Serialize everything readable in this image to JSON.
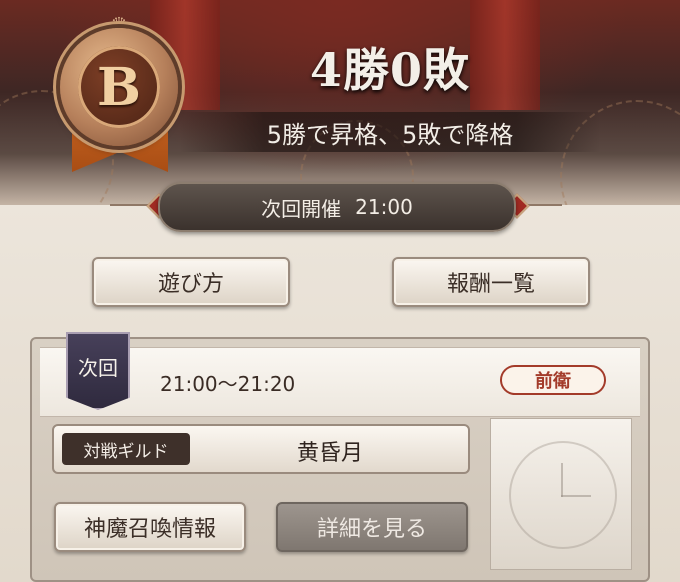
{
  "header": {
    "rank_letter": "B",
    "score": "4勝0敗",
    "rule": "5勝で昇格、5敗で降格"
  },
  "schedule": {
    "label": "次回開催",
    "time": "21:00"
  },
  "buttons": {
    "how_to_play": "遊び方",
    "rewards": "報酬一覧",
    "summon_info": "神魔召喚情報",
    "details": "詳細を見る"
  },
  "match": {
    "flag_label": "次回",
    "time_range": "21:00～21:20",
    "role": "前衛",
    "opponent_label": "対戦ギルド",
    "opponent_name": "黄昏月"
  },
  "colors": {
    "accent_red": "#a33b2a",
    "banner_dark": "#3e2724",
    "paper": "#eae3d9"
  }
}
